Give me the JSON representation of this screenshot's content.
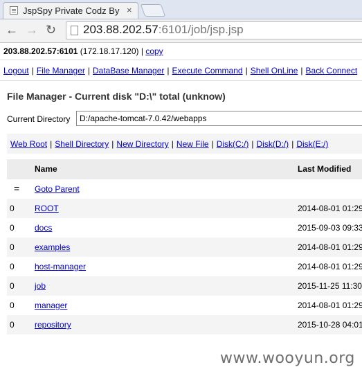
{
  "browser": {
    "tab_title": "JspSpy Private Codz By",
    "tab_close": "×",
    "url_host": "203.88.202.57",
    "url_rest": ":6101/job/jsp.jsp"
  },
  "header": {
    "host": "203.88.202.57:6101",
    "ip": "(172.18.17.120)",
    "divider": "|",
    "copy_label": "copy"
  },
  "menu": {
    "items": [
      "Logout",
      "File Manager",
      "DataBase Manager",
      "Execute Command",
      "Shell OnLine",
      "Back Connect"
    ],
    "divider": "|"
  },
  "file_manager": {
    "heading": "File Manager - Current disk \"D:\\\" total (unknow)",
    "current_dir_label": "Current Directory",
    "current_dir_value": "D:/apache-tomcat-7.0.42/webapps",
    "actions": [
      "Web Root",
      "Shell Directory",
      "New Directory",
      "New File",
      "Disk(C:/)",
      "Disk(D:/)",
      "Disk(E:/)"
    ],
    "col_name": "Name",
    "col_modified": "Last Modified",
    "parent_symbol": "=",
    "parent_label": "Goto Parent",
    "dir_symbol": "0",
    "rows": [
      {
        "name": "ROOT",
        "modified": "2014-08-01 01:29"
      },
      {
        "name": "docs",
        "modified": "2015-09-03 09:33"
      },
      {
        "name": "examples",
        "modified": "2014-08-01 01:29"
      },
      {
        "name": "host-manager",
        "modified": "2014-08-01 01:29"
      },
      {
        "name": "job",
        "modified": "2015-11-25 11:30"
      },
      {
        "name": "manager",
        "modified": "2014-08-01 01:29"
      },
      {
        "name": "repository",
        "modified": "2015-10-28 04:01"
      }
    ]
  },
  "watermark": "www.wooyun.org"
}
